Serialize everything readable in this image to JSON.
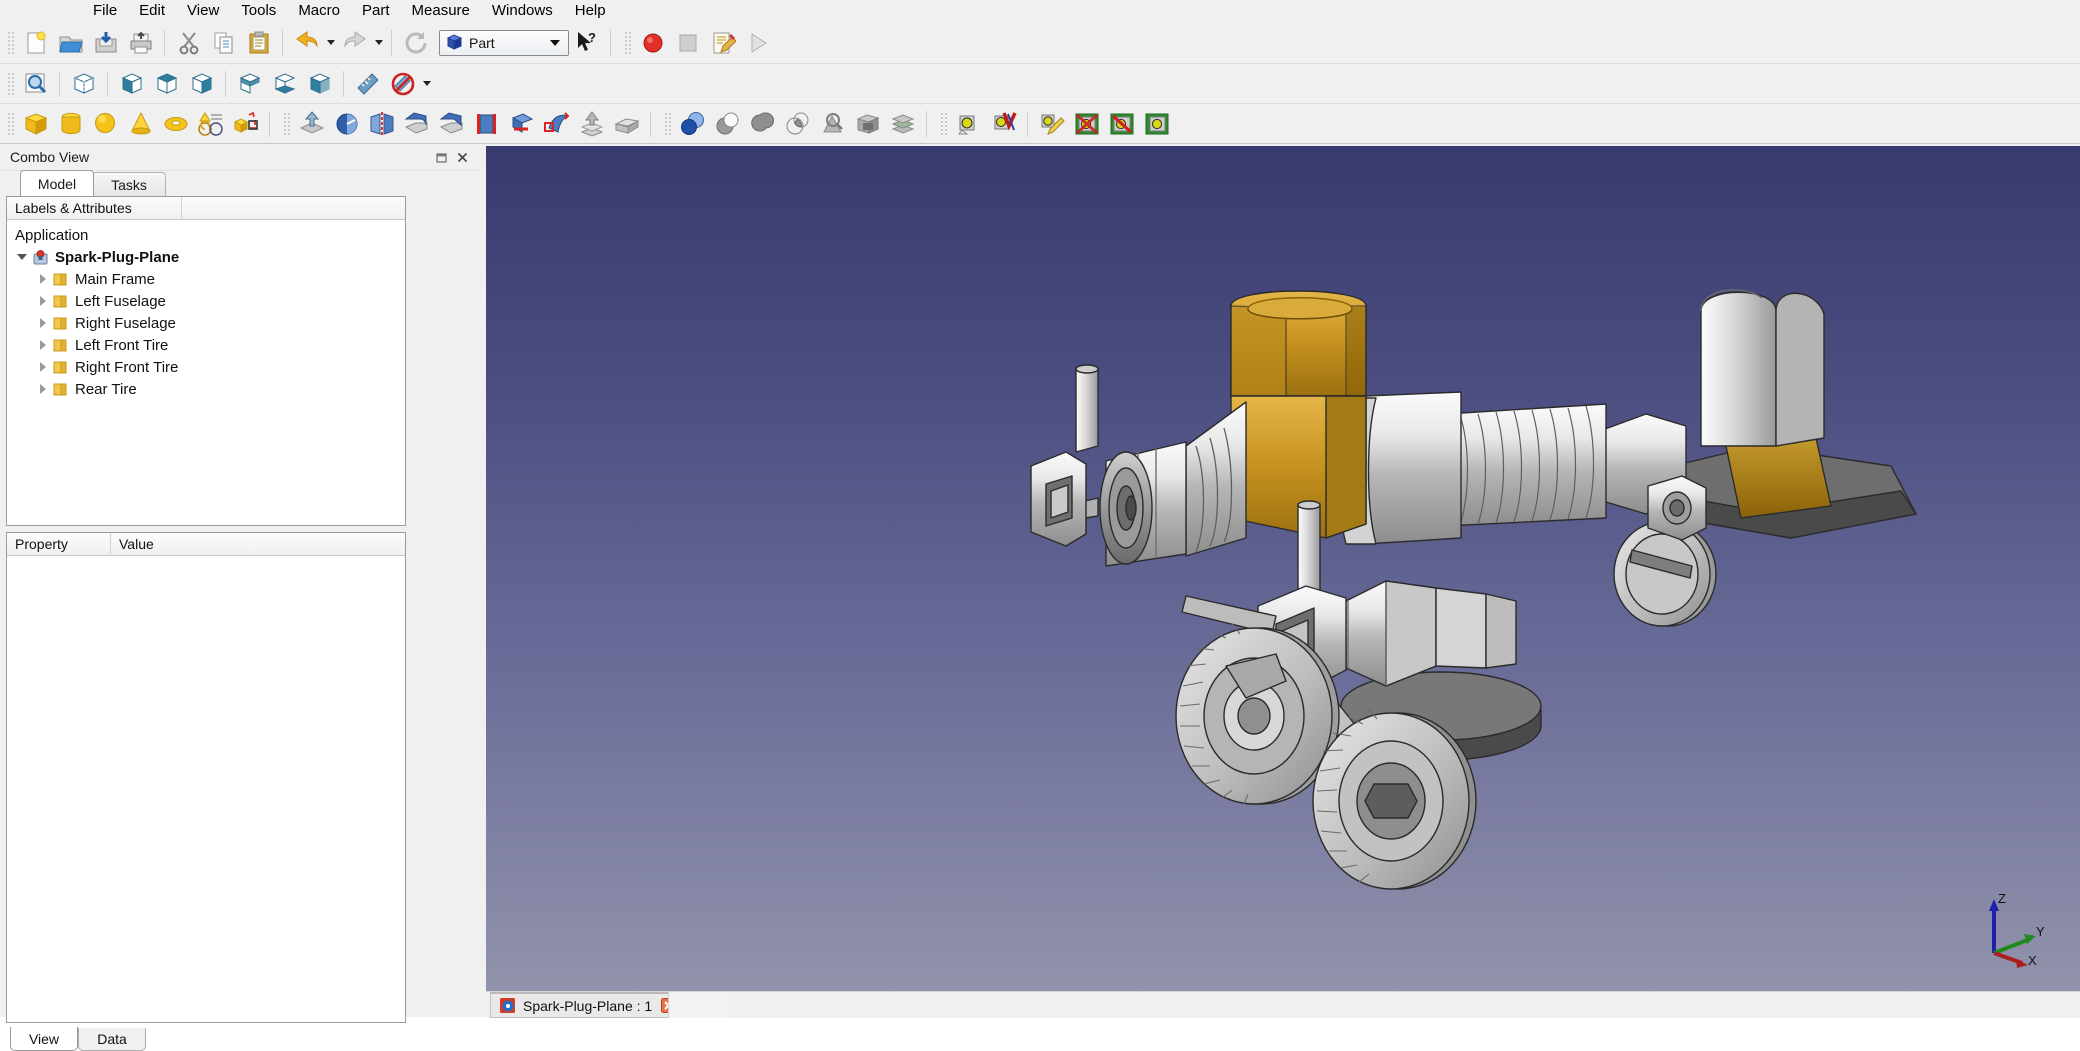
{
  "app": {
    "workbench": "Part",
    "accent": "#3a6ea5",
    "view_bg_top": "#383a70",
    "view_bg_bottom": "#9293ac"
  },
  "menubar": {
    "items": [
      {
        "label": "File"
      },
      {
        "label": "Edit"
      },
      {
        "label": "View"
      },
      {
        "label": "Tools"
      },
      {
        "label": "Macro"
      },
      {
        "label": "Part"
      },
      {
        "label": "Measure"
      },
      {
        "label": "Windows"
      },
      {
        "label": "Help"
      }
    ]
  },
  "toolbars": {
    "file": [
      {
        "name": "new-document-button",
        "icon": "new-file-icon"
      },
      {
        "name": "open-document-button",
        "icon": "open-folder-icon"
      },
      {
        "name": "save-document-button",
        "icon": "save-icon"
      },
      {
        "name": "print-button",
        "icon": "printer-icon"
      },
      {
        "name": "cut-button",
        "icon": "scissors-icon"
      },
      {
        "name": "copy-button",
        "icon": "copy-icon"
      },
      {
        "name": "paste-button",
        "icon": "clipboard-icon"
      },
      {
        "name": "undo-button",
        "icon": "undo-arrow-icon"
      },
      {
        "name": "redo-button",
        "icon": "redo-arrow-icon"
      },
      {
        "name": "refresh-button",
        "icon": "refresh-icon"
      }
    ],
    "macro": [
      {
        "name": "macro-record-button",
        "icon": "record-circle-icon"
      },
      {
        "name": "macro-stop-button",
        "icon": "stop-square-icon"
      },
      {
        "name": "macro-edit-button",
        "icon": "macro-edit-icon"
      },
      {
        "name": "macro-execute-button",
        "icon": "play-triangle-icon"
      }
    ],
    "view": [
      {
        "name": "fit-all-button",
        "icon": "fit-all-magnifier-icon"
      },
      {
        "name": "axonometric-view-button",
        "icon": "cube-axonometric-icon"
      },
      {
        "name": "front-view-button",
        "icon": "cube-front-icon"
      },
      {
        "name": "top-view-button",
        "icon": "cube-top-icon"
      },
      {
        "name": "right-view-button",
        "icon": "cube-right-icon"
      },
      {
        "name": "rear-view-button",
        "icon": "cube-rear-icon"
      },
      {
        "name": "bottom-view-button",
        "icon": "cube-bottom-icon"
      },
      {
        "name": "left-view-button",
        "icon": "cube-left-icon"
      },
      {
        "name": "measure-button",
        "icon": "ruler-icon"
      },
      {
        "name": "clear-measurement-button",
        "icon": "no-measure-icon"
      }
    ],
    "primitives": [
      {
        "name": "part-box-button",
        "icon": "yellow-box-icon"
      },
      {
        "name": "part-cylinder-button",
        "icon": "yellow-cylinder-icon"
      },
      {
        "name": "part-sphere-button",
        "icon": "yellow-sphere-icon"
      },
      {
        "name": "part-cone-button",
        "icon": "yellow-cone-icon"
      },
      {
        "name": "part-torus-button",
        "icon": "yellow-torus-icon"
      },
      {
        "name": "shape-builder-button",
        "icon": "shape-builder-icon"
      },
      {
        "name": "primitives-dialog-button",
        "icon": "primitives-icon"
      }
    ],
    "part": [
      {
        "name": "extrude-button",
        "icon": "extrude-icon"
      },
      {
        "name": "revolve-button",
        "icon": "revolve-icon"
      },
      {
        "name": "mirror-button",
        "icon": "mirror-icon"
      },
      {
        "name": "fillet-button",
        "icon": "fillet-icon"
      },
      {
        "name": "chamfer-button",
        "icon": "chamfer-icon"
      },
      {
        "name": "ruled-surface-button",
        "icon": "ruled-surface-icon"
      },
      {
        "name": "loft-button",
        "icon": "loft-icon"
      },
      {
        "name": "sweep-button",
        "icon": "sweep-icon"
      },
      {
        "name": "offset-button",
        "icon": "offset-icon"
      },
      {
        "name": "thickness-button",
        "icon": "thickness-icon"
      }
    ],
    "boolean": [
      {
        "name": "boolean-button",
        "icon": "boolean-spheres-icon"
      },
      {
        "name": "cut-shape-button",
        "icon": "boolean-cut-icon"
      },
      {
        "name": "union-button",
        "icon": "boolean-union-icon"
      },
      {
        "name": "intersection-button",
        "icon": "boolean-common-icon"
      },
      {
        "name": "check-geometry-button",
        "icon": "check-geometry-icon"
      },
      {
        "name": "section-button",
        "icon": "section-box-icon"
      },
      {
        "name": "cross-sections-button",
        "icon": "cross-sections-icon"
      }
    ],
    "measure": [
      {
        "name": "measure-toggle-all-button",
        "icon": "measure-toggle-icon"
      },
      {
        "name": "measure-validate-button",
        "icon": "measure-check-icon"
      },
      {
        "name": "measure-annotation-button",
        "icon": "measure-pencil-icon"
      },
      {
        "name": "measure-toggle-3d-button",
        "icon": "measure-3d-icon"
      },
      {
        "name": "measure-toggle-delta-button",
        "icon": "measure-delta-icon"
      },
      {
        "name": "measure-clear-all-button",
        "icon": "measure-clear-icon"
      }
    ],
    "whats_this": {
      "name": "whats-this-button",
      "icon": "whats-this-cursor-icon"
    }
  },
  "combo_view": {
    "title": "Combo View",
    "tabs": [
      {
        "label": "Model",
        "selected": true
      },
      {
        "label": "Tasks",
        "selected": false
      }
    ],
    "tree": {
      "columns": [
        "Labels & Attributes",
        ""
      ],
      "root": "Application",
      "document": {
        "label": "Spark-Plug-Plane",
        "expanded": true
      },
      "items": [
        {
          "label": "Main Frame"
        },
        {
          "label": "Left Fuselage"
        },
        {
          "label": "Right Fuselage"
        },
        {
          "label": "Left Front Tire"
        },
        {
          "label": "Right Front Tire"
        },
        {
          "label": "Rear Tire"
        }
      ]
    },
    "property_editor": {
      "columns": [
        "Property",
        "Value"
      ],
      "rows": []
    },
    "bottom_tabs": [
      {
        "label": "View",
        "selected": true
      },
      {
        "label": "Data",
        "selected": false
      }
    ]
  },
  "document_tabs": [
    {
      "label": "Spark-Plug-Plane : 1",
      "active": true
    }
  ],
  "view_3d": {
    "axis_labels": {
      "x": "X",
      "y": "Y",
      "z": "Z"
    },
    "axis_colors": {
      "x": "#aa1f1f",
      "y": "#1f8a1f",
      "z": "#1f1faa"
    },
    "model_name": "Spark-Plug-Plane"
  }
}
